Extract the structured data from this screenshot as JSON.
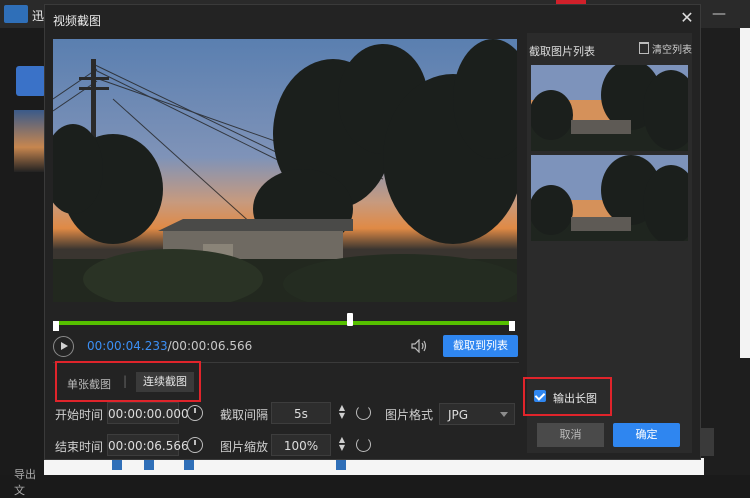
{
  "background_app": {
    "title": "迅",
    "export_label": "导出文"
  },
  "dialog": {
    "title": "视频截图",
    "player": {
      "current_time": "00:00:04.233",
      "separator": "/",
      "total_time": "00:00:06.566",
      "progress_fraction": 0.647,
      "add_to_list_label": "截取到列表"
    },
    "modes": {
      "single_label": "单张截图",
      "separator": "|",
      "continuous_label": "连续截图"
    },
    "settings": {
      "start_time_label": "开始时间",
      "start_time_value": "00:00:00.000",
      "end_time_label": "结束时间",
      "end_time_value": "00:00:06.566",
      "interval_label": "截取间隔",
      "interval_value": "5s",
      "scale_label": "图片缩放",
      "scale_value": "100%",
      "format_label": "图片格式",
      "format_value": "JPG"
    },
    "screenshot_list": {
      "title": "截取图片列表",
      "clear_label": "清空列表",
      "item_count": 2
    },
    "output_long_image": {
      "label": "输出长图",
      "checked": true
    },
    "buttons": {
      "cancel_label": "取消",
      "ok_label": "确定"
    }
  },
  "colors": {
    "accent_blue": "#2f86f0",
    "progress_green": "#56c000",
    "highlight_red": "#e0242b",
    "dialog_bg": "#232323"
  }
}
